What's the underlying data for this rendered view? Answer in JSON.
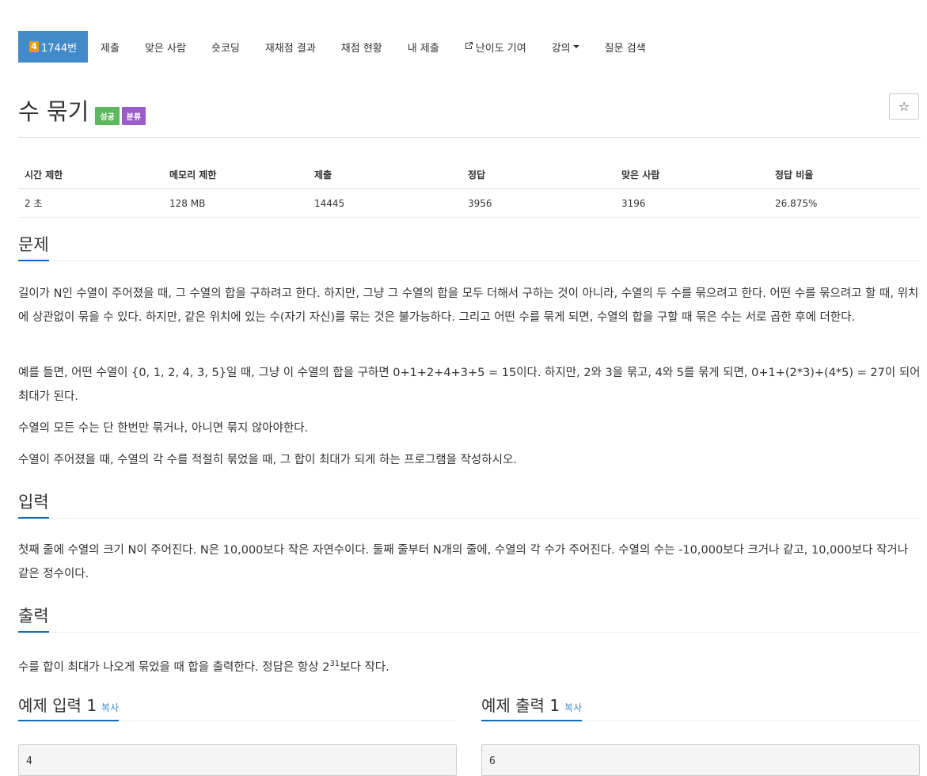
{
  "nav": {
    "tier": "4",
    "problem": "1744번",
    "items": [
      "제출",
      "맞은 사람",
      "숏코딩",
      "재채점 결과",
      "채점 현황",
      "내 제출",
      "난이도 기여",
      "강의",
      "질문 검색"
    ]
  },
  "problem": {
    "title": "수 묶기",
    "labels": [
      "성공",
      "분류"
    ]
  },
  "info": {
    "headers": [
      "시간 제한",
      "메모리 제한",
      "제출",
      "정답",
      "맞은 사람",
      "정답 비율"
    ],
    "values": [
      "2 초",
      "128 MB",
      "14445",
      "3956",
      "3196",
      "26.875%"
    ]
  },
  "sections": {
    "description": {
      "title": "문제",
      "paragraphs": [
        "길이가 N인 수열이 주어졌을 때, 그 수열의 합을 구하려고 한다. 하지만, 그냥 그 수열의 합을 모두 더해서 구하는 것이 아니라, 수열의 두 수를 묶으려고 한다. 어떤 수를 묶으려고 할 때, 위치에 상관없이 묶을 수 있다. 하지만, 같은 위치에 있는 수(자기 자신)를 묶는 것은 불가능하다. 그리고 어떤 수를 묶게 되면, 수열의 합을 구할 때 묶은 수는 서로 곱한 후에 더한다.",
        "예를 들면, 어떤 수열이 {0, 1, 2, 4, 3, 5}일 때, 그냥 이 수열의 합을 구하면 0+1+2+4+3+5 = 15이다. 하지만, 2와 3을 묶고, 4와 5를 묶게 되면, 0+1+(2*3)+(4*5) = 27이 되어 최대가 된다.",
        "수열의 모든 수는 단 한번만 묶거나, 아니면 묶지 않아야한다.",
        "수열이 주어졌을 때, 수열의 각 수를 적절히 묶었을 때, 그 합이 최대가 되게 하는 프로그램을 작성하시오."
      ]
    },
    "input": {
      "title": "입력",
      "text": "첫째 줄에 수열의 크기 N이 주어진다. N은 10,000보다 작은 자연수이다. 둘째 줄부터 N개의 줄에, 수열의 각 수가 주어진다. 수열의 수는 -10,000보다 크거나 같고, 10,000보다 작거나 같은 정수이다."
    },
    "output": {
      "title": "출력",
      "text_before": "수를 합이 최대가 나오게 묶었을 때 합을 출력한다. 정답은 항상 2",
      "superscript": "31",
      "text_after": "보다 작다."
    }
  },
  "samples": {
    "input": {
      "title": "예제 입력 1",
      "copy": "복사",
      "value": "4"
    },
    "output": {
      "title": "예제 출력 1",
      "copy": "복사",
      "value": "6"
    }
  },
  "icons": {
    "external": "external-link-icon",
    "star": "star-icon",
    "caret": "caret-down-icon"
  },
  "colors": {
    "active_nav": "#428bca",
    "tier": "#ec9a00",
    "success": "#5cb85c",
    "category": "#9c5bca",
    "accent": "#0e6dba"
  }
}
